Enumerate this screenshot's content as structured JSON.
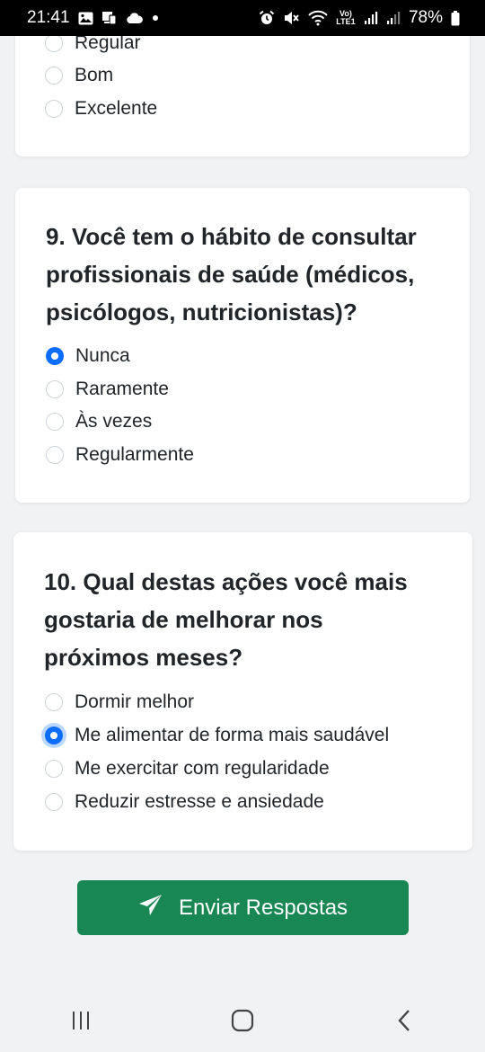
{
  "status_bar": {
    "time": "21:41",
    "battery": "78%",
    "network_label": "Vo) LTE1",
    "left_icons": [
      "image-icon",
      "screen-icon",
      "cloud-icon",
      "dot-icon"
    ],
    "right_icons": [
      "alarm-icon",
      "mute-icon",
      "wifi-icon",
      "lte-icon",
      "signal-icon",
      "signal-icon",
      "battery-icon"
    ]
  },
  "q8": {
    "options": [
      {
        "label": "Regular",
        "checked": false
      },
      {
        "label": "Bom",
        "checked": false
      },
      {
        "label": "Excelente",
        "checked": false
      }
    ]
  },
  "q9": {
    "question": "9. Você tem o hábito de consultar profissionais de saúde (médicos, psicólogos, nutricionistas)?",
    "lines": [
      "9. Você tem o hábito de consultar",
      "profissionais de saúde (médicos,",
      "psicólogos, nutricionistas)?"
    ],
    "options": [
      {
        "label": "Nunca",
        "checked": true
      },
      {
        "label": "Raramente",
        "checked": false
      },
      {
        "label": "Às vezes",
        "checked": false
      },
      {
        "label": "Regularmente",
        "checked": false
      }
    ]
  },
  "q10": {
    "question": "10. Qual destas ações você mais gostaria de melhorar nos próximos meses?",
    "lines": [
      "10. Qual destas ações você mais",
      "gostaria de melhorar nos",
      "próximos meses?"
    ],
    "options": [
      {
        "label": "Dormir melhor",
        "checked": false
      },
      {
        "label": "Me alimentar de forma mais saudável",
        "checked": true
      },
      {
        "label": "Me exercitar com regularidade",
        "checked": false
      },
      {
        "label": "Reduzir estresse e ansiedade",
        "checked": false
      }
    ]
  },
  "submit": {
    "label": "Enviar Respostas",
    "icon": "send-icon",
    "color": "#198754"
  },
  "accent_color": "#0d6efd",
  "nav": {
    "icons": [
      "recent-apps-icon",
      "home-icon",
      "back-icon"
    ]
  }
}
